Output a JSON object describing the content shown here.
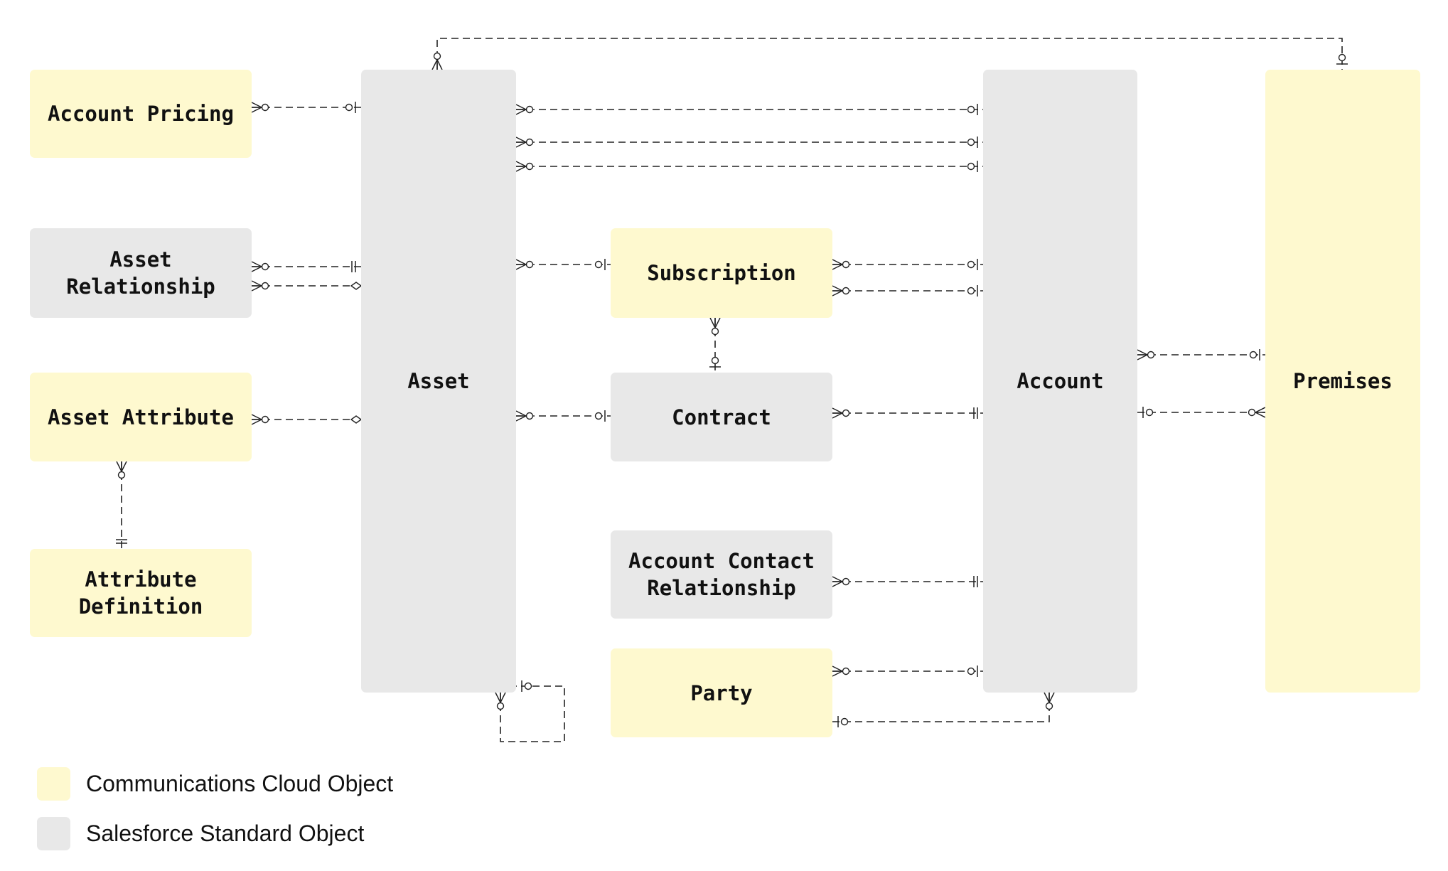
{
  "colors": {
    "communications_cloud": "#fef9cf",
    "salesforce_standard": "#e8e8e8",
    "line": "#222222"
  },
  "entities": {
    "account_pricing": "Account Pricing",
    "asset_relationship": "Asset Relationship",
    "asset_attribute": "Asset Attribute",
    "attribute_definition": "Attribute Definition",
    "asset": "Asset",
    "subscription": "Subscription",
    "contract": "Contract",
    "account_contact_relationship": "Account Contact Relationship",
    "party": "Party",
    "account": "Account",
    "premises": "Premises"
  },
  "legend": [
    {
      "label": "Communications Cloud Object",
      "color": "#fef9cf"
    },
    {
      "label": "Salesforce Standard Object",
      "color": "#e8e8e8"
    }
  ]
}
